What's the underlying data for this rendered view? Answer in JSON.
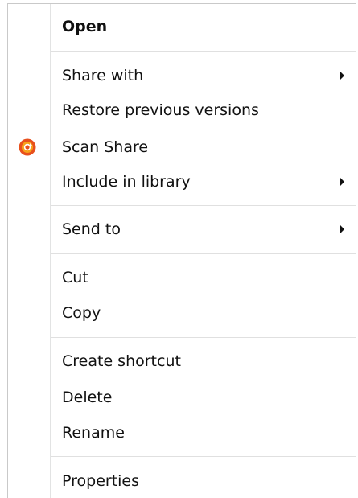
{
  "menu": {
    "open_label": "Open",
    "share_with_label": "Share with",
    "restore_label": "Restore previous versions",
    "scan_share_label": "Scan Share",
    "include_library_label": "Include in library",
    "send_to_label": "Send to",
    "cut_label": "Cut",
    "copy_label": "Copy",
    "create_shortcut_label": "Create shortcut",
    "delete_label": "Delete",
    "rename_label": "Rename",
    "properties_label": "Properties"
  },
  "icons": {
    "scan_share": "avast-scan-icon",
    "submenu": "chevron-right-icon"
  },
  "colors": {
    "scan_icon_outer": "#e8501d",
    "scan_icon_inner": "#f7a21b",
    "separator": "#e0e0e0"
  }
}
